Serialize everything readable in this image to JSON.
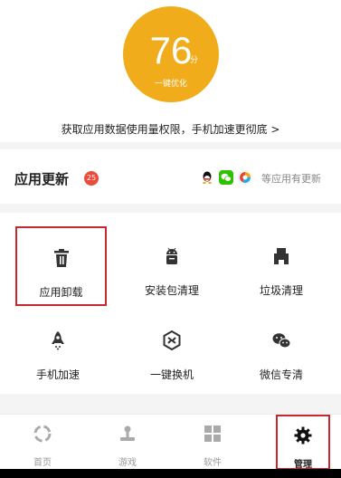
{
  "score": {
    "value": "76",
    "unit": "分",
    "label": "一键优化",
    "circle_color": "#f0ac1a",
    "permission_link": "获取应用数据使用量权限，手机加速更彻底 >"
  },
  "updates": {
    "title": "应用更新",
    "badge": "25",
    "badge_color": "#ec4a3a",
    "apps": [
      {
        "icon": "qq-icon"
      },
      {
        "icon": "wechat-icon"
      },
      {
        "icon": "browser-icon"
      }
    ],
    "suffix": "等应用有更新"
  },
  "tools": [
    {
      "label": "应用卸载",
      "icon": "trash-icon",
      "selected": true
    },
    {
      "label": "安装包清理",
      "icon": "android-icon"
    },
    {
      "label": "垃圾清理",
      "icon": "dustbin-icon"
    },
    {
      "label": "手机加速",
      "icon": "rocket-icon"
    },
    {
      "label": "一键换机",
      "icon": "phone-switch-icon"
    },
    {
      "label": "微信专清",
      "icon": "wechat-clean-icon"
    }
  ],
  "nav": [
    {
      "label": "首页",
      "icon": "home-icon"
    },
    {
      "label": "游戏",
      "icon": "game-icon"
    },
    {
      "label": "软件",
      "icon": "apps-grid-icon"
    },
    {
      "label": "管理",
      "icon": "gear-icon",
      "active": true,
      "selected": true
    }
  ],
  "accent_color": "#c7272f"
}
